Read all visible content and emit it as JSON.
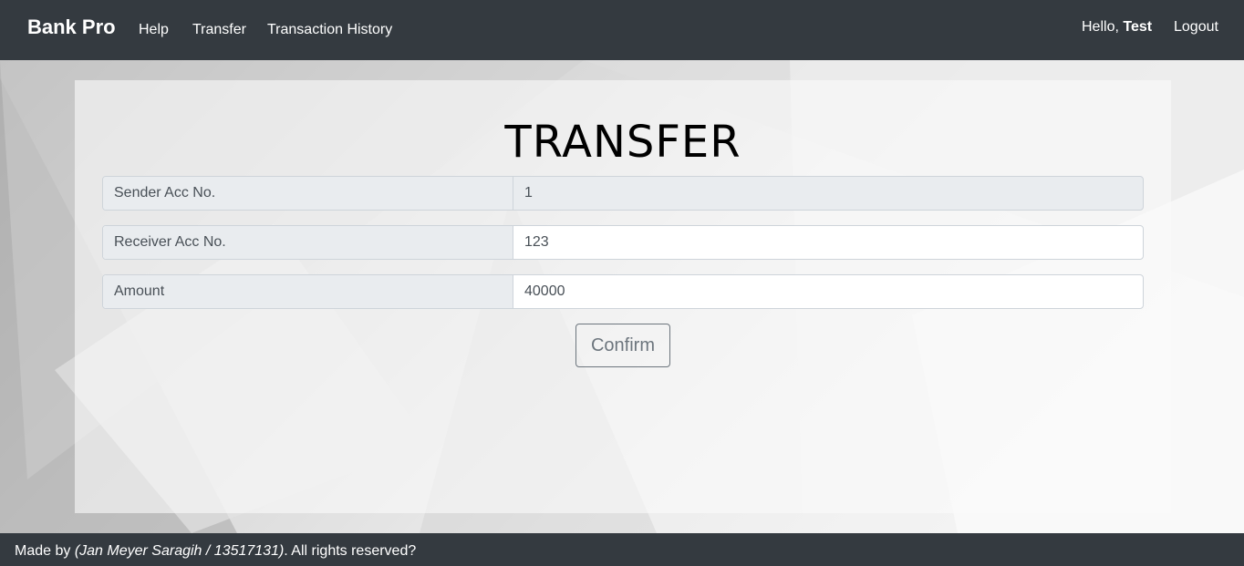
{
  "navbar": {
    "brand": "Bank Pro",
    "links": [
      {
        "label": "Help"
      },
      {
        "label": "Transfer"
      },
      {
        "label": "Transaction History"
      }
    ],
    "greeting_prefix": "Hello,",
    "user_name": "Test",
    "logout_label": "Logout"
  },
  "form": {
    "title": "TRANSFER",
    "fields": [
      {
        "label": "Sender Acc No.",
        "value": "1"
      },
      {
        "label": "Receiver Acc No.",
        "value": "123"
      },
      {
        "label": "Amount",
        "value": "40000"
      }
    ],
    "confirm_label": "Confirm"
  },
  "footer": {
    "prefix": "Made by",
    "author": "(Jan Meyer Saragih / 13517131)",
    "suffix": ". All rights reserved?"
  },
  "colors": {
    "navbar_bg": "#343a40",
    "input_group_bg": "#e9ecef",
    "border": "#ced4da",
    "button_outline": "#6c757d"
  }
}
